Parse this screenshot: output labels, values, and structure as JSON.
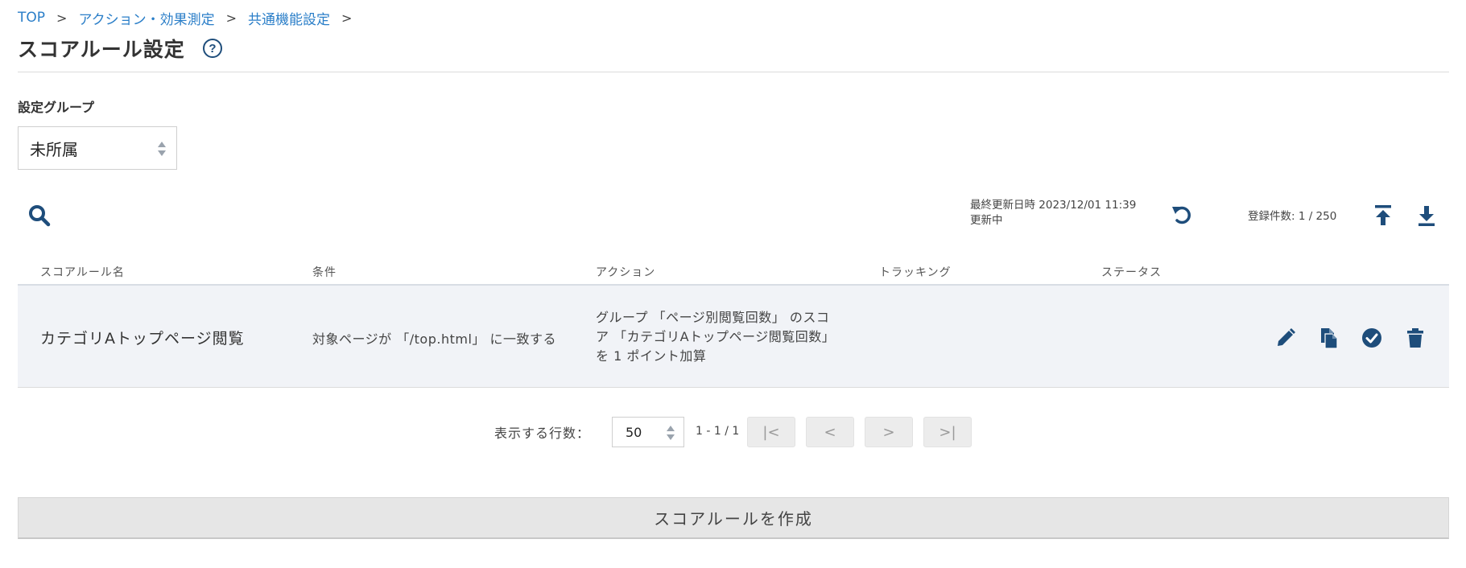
{
  "breadcrumb": {
    "items": [
      "TOP",
      "アクション・効果測定",
      "共通機能設定"
    ],
    "separator": ">"
  },
  "page": {
    "title": "スコアルール設定",
    "help_symbol": "?"
  },
  "group": {
    "label": "設定グループ",
    "selected": "未所属"
  },
  "toolbar": {
    "last_updated_line1": "最終更新日時 2023/12/01 11:39",
    "last_updated_line2": "更新中",
    "count": "登録件数: 1 / 250",
    "icons": [
      "search-icon",
      "refresh-icon",
      "upload-icon",
      "download-icon"
    ]
  },
  "table": {
    "columns": [
      "スコアルール名",
      "条件",
      "アクション",
      "トラッキング",
      "ステータス"
    ],
    "rows": [
      {
        "name": "カテゴリAトップページ閲覧",
        "condition": "対象ページが 「/top.html」 に一致する",
        "action_lines": [
          "グループ 「ページ別閲覧回数」 のスコ",
          "ア 「カテゴリAトップページ閲覧回数」",
          "を 1 ポイント加算"
        ],
        "tracking": "",
        "status": "",
        "row_icons": [
          "edit-icon",
          "copy-icon",
          "check-circle-icon",
          "trash-icon"
        ]
      }
    ]
  },
  "pagination": {
    "rows_label": "表示する行数：",
    "rows_value": "50",
    "range": "1 - 1 / 1",
    "first": "|<",
    "prev": "<",
    "next": ">",
    "last": ">|"
  },
  "create_button": "スコアルールを作成",
  "colors": {
    "link": "#2a7ec8",
    "icon": "#1e4d7b",
    "row_bg": "#f1f3f7"
  }
}
